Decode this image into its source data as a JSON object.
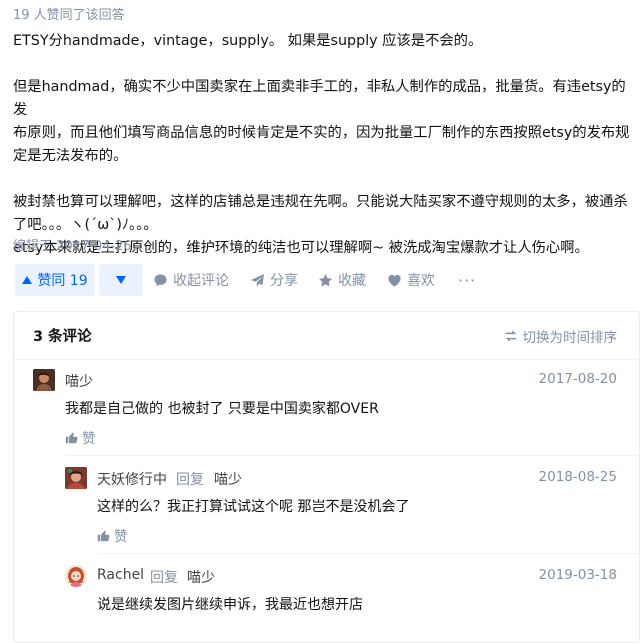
{
  "answer": {
    "upvote_summary": "19 人赞同了该回答",
    "paragraphs": [
      "ETSY分handmade，vintage，supply。 如果是supply 应该是不会的。",
      "",
      "但是handmad，确实不少中国卖家在上面卖非手工的，非私人制作的成品，批量货。有违etsy的发",
      "布原则，而且他们填写商品信息的时候肯定是不实的，因为批量工厂制作的东西按照etsy的发布规",
      "定是无法发布的。",
      "",
      "被封禁也算可以理解吧，这样的店铺总是违规在先啊。只能说大陆买家不遵守规则的太多，被通杀",
      "了吧。。。ヽ(ˊωˋ)ﾉ。。。",
      "etsy本来就是主打原创的，维护环境的纯洁也可以理解啊~ 被洗成淘宝爆款才让人伤心啊。"
    ],
    "edited": "编辑于 2017-04-26"
  },
  "actions": {
    "vote_up": "赞同 19",
    "collapse_comment": "收起评论",
    "share": "分享",
    "favorite": "收藏",
    "like": "喜欢",
    "more": "···"
  },
  "comments": {
    "header": "3 条评论",
    "sort_label": "切换为时间排序",
    "items": [
      {
        "author": "喵少",
        "date": "2017-08-20",
        "text": "我都是自己做的 也被封了 只要是中国卖家都OVER",
        "like": "赞"
      },
      {
        "author": "天妖修行中",
        "reply_word": "回复",
        "reply_to": "喵少",
        "date": "2018-08-25",
        "text": "这样的么？我正打算试试这个呢 那岂不是没机会了",
        "like": "赞"
      },
      {
        "author": "Rachel",
        "reply_word": "回复",
        "reply_to": "喵少",
        "date": "2019-03-18",
        "text": "说是继续发图片继续申诉，我最近也想开店"
      }
    ]
  },
  "colors": {
    "accent": "#0066ff",
    "accent_bg": "#eaf2ff",
    "muted": "#8590a6"
  }
}
